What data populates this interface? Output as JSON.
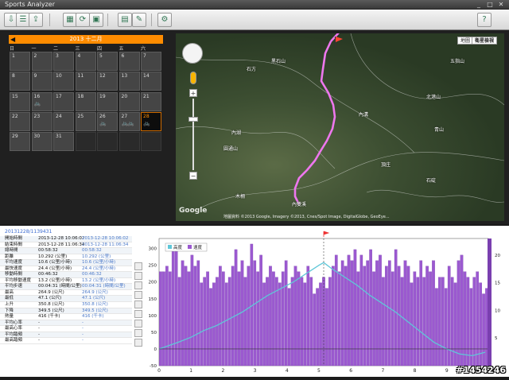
{
  "app": {
    "title": "Sports Analyzer",
    "min": "_",
    "max": "□",
    "close": "✕"
  },
  "toolbar": {
    "icons": [
      "import-icon",
      "list-icon",
      "export-icon",
      "image-icon",
      "refresh-icon",
      "save-icon",
      "print-icon",
      "edit-icon",
      "settings-icon",
      "help-icon"
    ],
    "glyphs": [
      "⇩",
      "☰",
      "⇪",
      "▦",
      "⟳",
      "▣",
      "▤",
      "✎",
      "⚙",
      "?"
    ]
  },
  "calendar": {
    "month_label": "2013 十二月",
    "prev": "◀",
    "days": [
      "日",
      "一",
      "二",
      "三",
      "四",
      "五",
      "六"
    ],
    "weeks": [
      [
        {
          "d": "1"
        },
        {
          "d": "2"
        },
        {
          "d": "3"
        },
        {
          "d": "4"
        },
        {
          "d": "5"
        },
        {
          "d": "6"
        },
        {
          "d": "7"
        }
      ],
      [
        {
          "d": "8"
        },
        {
          "d": "9"
        },
        {
          "d": "10"
        },
        {
          "d": "11"
        },
        {
          "d": "12"
        },
        {
          "d": "13"
        },
        {
          "d": "14"
        }
      ],
      [
        {
          "d": "15"
        },
        {
          "d": "16",
          "b": "🚲"
        },
        {
          "d": "17"
        },
        {
          "d": "18"
        },
        {
          "d": "19"
        },
        {
          "d": "20"
        },
        {
          "d": "21"
        }
      ],
      [
        {
          "d": "22"
        },
        {
          "d": "23"
        },
        {
          "d": "24"
        },
        {
          "d": "25"
        },
        {
          "d": "26",
          "b": "🚲"
        },
        {
          "d": "27",
          "b": "🚲🚲"
        },
        {
          "d": "28",
          "b": "🚲",
          "sel": true
        }
      ],
      [
        {
          "d": "29"
        },
        {
          "d": "30"
        },
        {
          "d": "31"
        },
        {
          "d": "",
          "e": true
        },
        {
          "d": "",
          "e": true
        },
        {
          "d": "",
          "e": true
        },
        {
          "d": "",
          "e": true
        }
      ]
    ]
  },
  "map": {
    "type_map": "地圖",
    "type_sat": "衛星檢視",
    "logo": "Google",
    "copyright": "地圖資料 ©2013 Google, Imagery ©2013, Cnes/Spot Image, DigitalGlobe, GeoEye...",
    "labels": [
      "石方",
      "黑石山",
      "內湖",
      "圓通山",
      "木柵",
      "頂庄",
      "內溝",
      "五指山",
      "北港山",
      "青山",
      "石碇",
      "內雙溪"
    ]
  },
  "stats": {
    "header": "20131228/1139431",
    "rows": [
      [
        "開始時間",
        "2013-12-28 10:06:02",
        "2013-12-28 10:06:02"
      ],
      [
        "結束時間",
        "2013-12-28 11:06:34",
        "2013-12-28 11:06:34"
      ],
      [
        "總時間",
        "00:58:32",
        "00:58:32"
      ],
      [
        "距離",
        "10.292 (公里)",
        "10.292 (公里)"
      ],
      [
        "平均速度",
        "10.6 (公里/小時)",
        "10.6 (公里/小時)"
      ],
      [
        "最快速度",
        "24.4 (公里/小時)",
        "24.4 (公里/小時)"
      ],
      [
        "移動時間",
        "00:46:32",
        "00:46:32"
      ],
      [
        "平均移動速度",
        "13.2 (公里/小時)",
        "13.2 (公里/小時)"
      ],
      [
        "平均步速",
        "00:04:31 (時間/公里)",
        "00:04:31 (時間/公里)"
      ],
      [
        "最高",
        "264.9 (公尺)",
        "264.9 (公尺)"
      ],
      [
        "最低",
        "47.1 (公尺)",
        "47.1 (公尺)"
      ],
      [
        "上升",
        "350.8 (公尺)",
        "350.8 (公尺)"
      ],
      [
        "下降",
        "349.5 (公尺)",
        "349.5 (公尺)"
      ],
      [
        "熱量",
        "416 (千卡)",
        "416 (千卡)"
      ],
      [
        "平均心率",
        "-",
        "-"
      ],
      [
        "最高心率",
        "-",
        "-"
      ],
      [
        "平均踏頻",
        "-",
        "-"
      ],
      [
        "最高踏頻",
        "-",
        "-"
      ]
    ]
  },
  "chart_data": {
    "type": "bar",
    "legend": [
      "高度",
      "速度"
    ],
    "x_ticks": [
      "0",
      "1",
      "2",
      "3",
      "4",
      "5",
      "6",
      "7",
      "8",
      "9",
      "10"
    ],
    "y_left_ticks": [
      "300",
      "250",
      "200",
      "150",
      "100",
      "50",
      "0",
      "-50"
    ],
    "y_right_ticks": [
      "20",
      "15",
      "10",
      "5"
    ],
    "marker_x": 5.15,
    "xlim": [
      0,
      10.3
    ],
    "ylim_left": [
      -50,
      330
    ],
    "ylim_right": [
      0,
      23
    ],
    "speed": [
      17,
      17,
      18,
      17,
      22,
      21,
      16,
      19,
      18,
      17,
      20,
      18,
      19,
      15,
      16,
      17,
      14,
      15,
      16,
      18,
      17,
      15,
      16,
      18,
      21,
      17,
      19,
      16,
      18,
      22,
      19,
      17,
      20,
      15,
      16,
      18,
      17,
      16,
      15,
      17,
      19,
      14,
      16,
      18,
      17,
      16,
      15,
      18,
      16,
      13,
      14,
      15,
      16,
      14,
      16,
      18,
      20,
      17,
      19,
      18,
      20,
      19,
      21,
      17,
      20,
      18,
      19,
      21,
      17,
      19,
      20,
      16,
      18,
      19,
      17,
      21,
      18,
      16,
      19,
      18,
      15,
      17,
      16,
      19,
      16,
      18,
      17,
      19,
      14,
      16,
      16,
      14,
      18,
      16,
      15,
      19,
      20,
      17,
      16,
      14,
      16,
      17,
      15,
      13,
      14
    ],
    "elev_x": [
      0,
      0.3,
      0.6,
      1.0,
      1.4,
      1.8,
      2.2,
      2.6,
      3.0,
      3.4,
      3.8,
      4.2,
      4.6,
      5.0,
      5.15,
      5.4,
      5.8,
      6.2,
      6.6,
      7.0,
      7.4,
      7.8,
      8.2,
      8.6,
      9.0,
      9.4,
      9.8,
      10.2
    ],
    "elev": [
      0,
      10,
      20,
      35,
      55,
      70,
      90,
      110,
      135,
      160,
      180,
      200,
      225,
      250,
      258,
      240,
      215,
      190,
      160,
      135,
      110,
      80,
      50,
      20,
      0,
      -15,
      -20,
      -10
    ]
  }
}
